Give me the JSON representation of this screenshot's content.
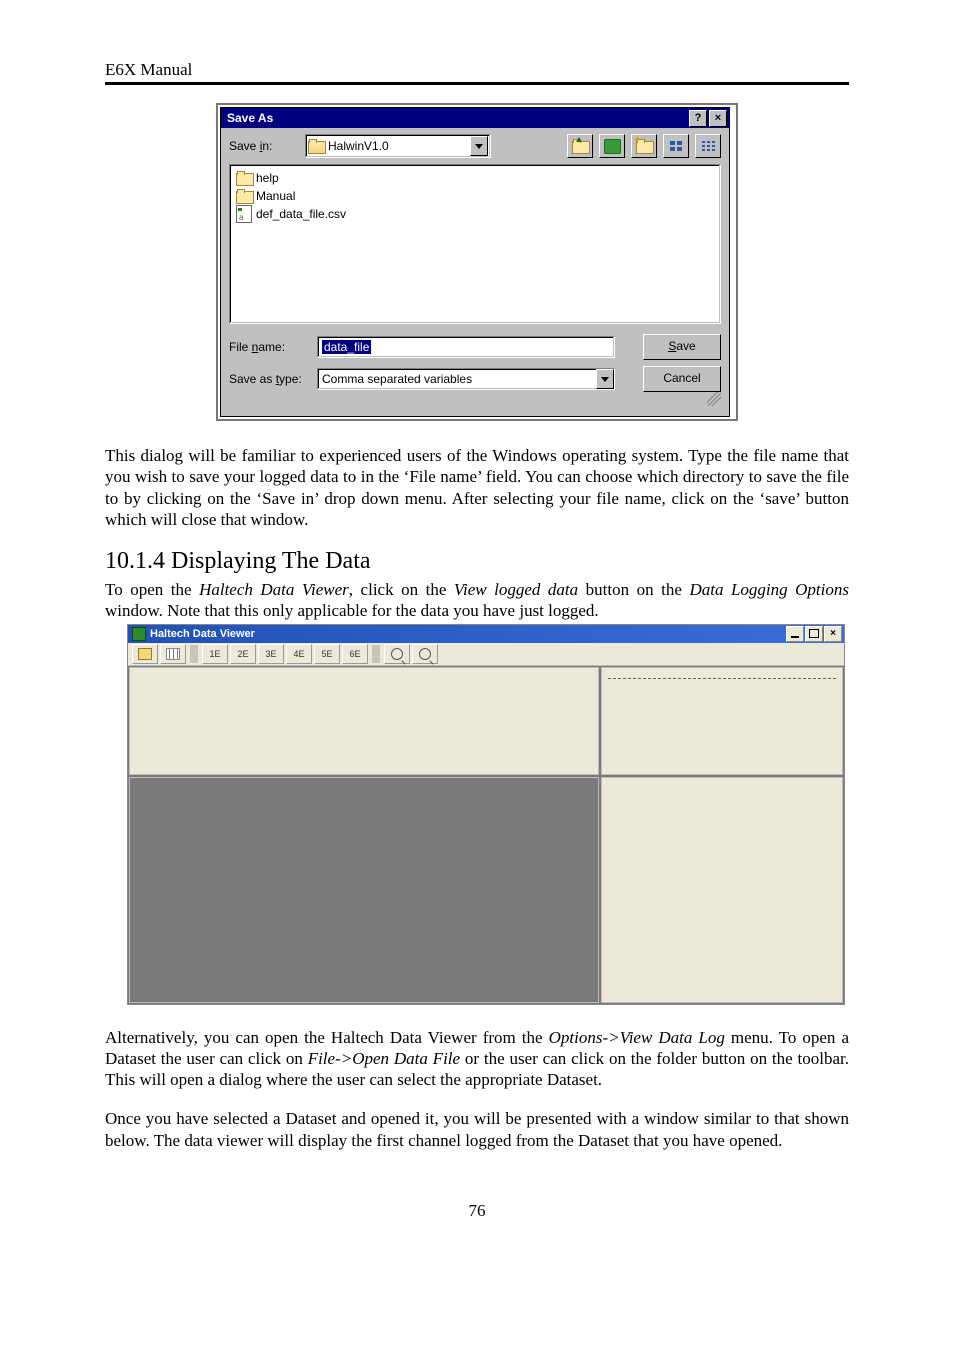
{
  "doc_header": "E6X Manual",
  "save_as": {
    "title": "Save As",
    "help_btn": "?",
    "close_btn": "×",
    "save_in_label_pre": "Save ",
    "save_in_label_u": "i",
    "save_in_label_post": "n:",
    "save_in_value": "HalwinV1.0",
    "files": {
      "folder1": "help",
      "folder2": "Manual",
      "csv1": "def_data_file.csv"
    },
    "file_name_label_pre": "File ",
    "file_name_label_u": "n",
    "file_name_label_post": "ame:",
    "file_name_value": "data_file",
    "save_type_label_pre": "Save as ",
    "save_type_label_u": "t",
    "save_type_label_post": "ype:",
    "save_type_value": "Comma separated variables",
    "save_btn_u": "S",
    "save_btn_post": "ave",
    "cancel_btn": "Cancel"
  },
  "para1": "This dialog will be familiar to experienced users of the Windows operating system. Type the file name that you wish to save your logged data to in the ‘File name’ field. You can choose which directory to save the file to by clicking on the ‘Save in’ drop down menu. After selecting your file name, click on the ‘save’ button which will close that window.",
  "section_heading": "10.1.4 Displaying The Data",
  "para2_pre": "To open the ",
  "para2_i1": "Haltech Data Viewer",
  "para2_mid1": ", click on the ",
  "para2_i2": "View logged data",
  "para2_mid2": " button on the ",
  "para2_i3": "Data Logging Options",
  "para2_post": " window. Note that this only applicable for the data you have just logged.",
  "haltech": {
    "title": "Haltech Data Viewer",
    "toolbar_counts": [
      "1E",
      "2E",
      "3E",
      "4E",
      "5E",
      "6E"
    ]
  },
  "para3_pre": "Alternatively, you can open the Haltech Data Viewer from the ",
  "para3_i1": "Options->View Data Log",
  "para3_mid": " menu. To open a Dataset the user can click on ",
  "para3_i2": "File->Open Data File",
  "para3_post": " or the user can click on the folder button on the toolbar. This will open a dialog where the user can select the appropriate Dataset.",
  "para4": "Once you have selected a Dataset and opened it, you will be presented with a window similar to that shown below. The data viewer will display the first channel logged from the Dataset that you have opened.",
  "page_number": "76"
}
